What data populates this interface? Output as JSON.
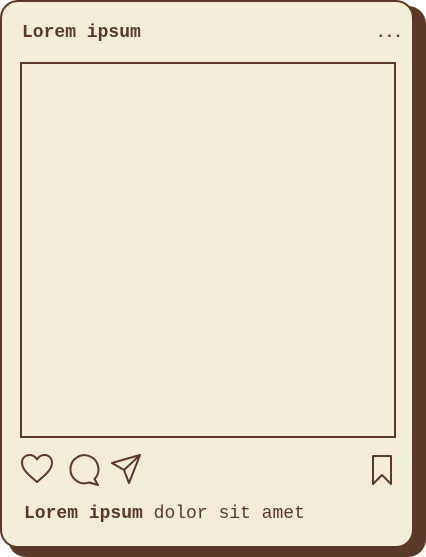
{
  "post": {
    "username": "Lorem ipsum",
    "more_label": "...",
    "caption_user": "Lorem ipsum",
    "caption_text": "dolor sit amet"
  },
  "actions": {
    "like_icon": "heart-icon",
    "comment_icon": "comment-icon",
    "share_icon": "send-icon",
    "save_icon": "bookmark-icon"
  },
  "colors": {
    "card_background": "#f3ecd6",
    "ink": "#5a3a26",
    "shadow": "#5a3a26"
  }
}
